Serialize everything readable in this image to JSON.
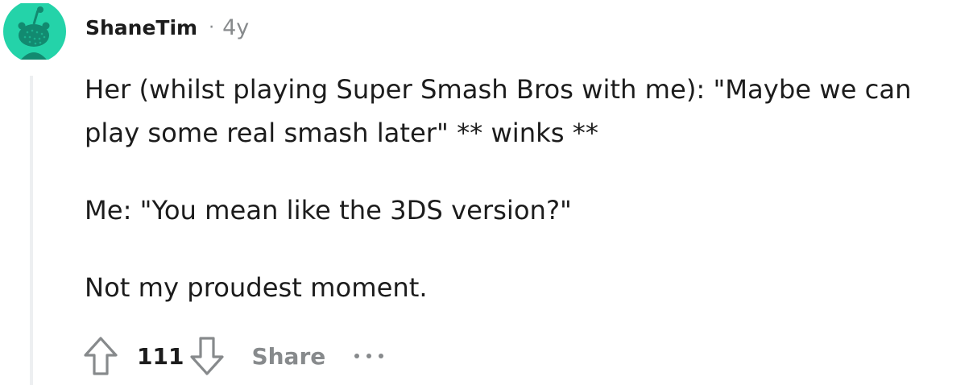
{
  "comment": {
    "author": "ShaneTim",
    "separator": "·",
    "age": "4y",
    "avatar_icon": "snoo-avatar-icon",
    "avatar_color": "#24d3a9",
    "body": [
      "Her (whilst playing Super Smash Bros with me): \"Maybe we can play some real smash later\" ** winks **",
      "Me: \"You mean like the 3DS version?\"",
      "Not my proudest moment."
    ]
  },
  "actions": {
    "upvote_icon": "upvote-arrow-icon",
    "score": "111",
    "downvote_icon": "downvote-arrow-icon",
    "share_label": "Share",
    "more_icon": "more-options-icon"
  }
}
